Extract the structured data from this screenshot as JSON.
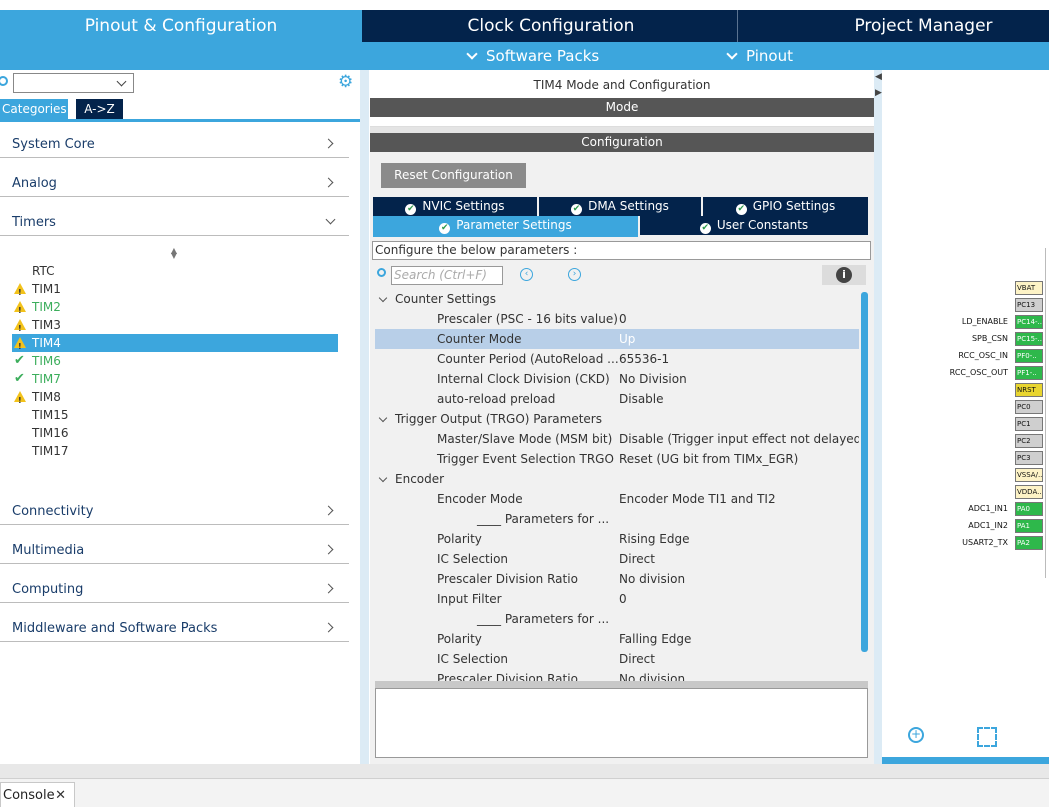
{
  "nav": {
    "tabs": [
      {
        "label": "Pinout & Configuration"
      },
      {
        "label": "Clock Configuration"
      },
      {
        "label": "Project Manager"
      }
    ],
    "sub": [
      {
        "label": "Software Packs"
      },
      {
        "label": "Pinout"
      }
    ]
  },
  "sidebar": {
    "tab_categories": "Categories",
    "tab_az": "A->Z",
    "categories_top": [
      {
        "label": "System Core"
      },
      {
        "label": "Analog"
      },
      {
        "label": "Timers"
      }
    ],
    "timers": [
      {
        "label": "RTC",
        "status": "none"
      },
      {
        "label": "TIM1",
        "status": "warning"
      },
      {
        "label": "TIM2",
        "status": "warning-green"
      },
      {
        "label": "TIM3",
        "status": "warning"
      },
      {
        "label": "TIM4",
        "status": "warning-selected"
      },
      {
        "label": "TIM6",
        "status": "ok"
      },
      {
        "label": "TIM7",
        "status": "ok"
      },
      {
        "label": "TIM8",
        "status": "warning"
      },
      {
        "label": "TIM15",
        "status": "none"
      },
      {
        "label": "TIM16",
        "status": "none"
      },
      {
        "label": "TIM17",
        "status": "none"
      }
    ],
    "categories_bottom": [
      {
        "label": "Connectivity"
      },
      {
        "label": "Multimedia"
      },
      {
        "label": "Computing"
      },
      {
        "label": "Middleware and Software Packs"
      }
    ]
  },
  "main": {
    "title": "TIM4 Mode and Configuration",
    "mode_header": "Mode",
    "config_header": "Configuration",
    "reset_button": "Reset Configuration",
    "settings_tabs": [
      {
        "label": "NVIC Settings"
      },
      {
        "label": "DMA Settings"
      },
      {
        "label": "GPIO Settings"
      },
      {
        "label": "Parameter Settings"
      },
      {
        "label": "User Constants"
      }
    ],
    "params_label": "Configure the below parameters :",
    "search_placeholder": "Search (Ctrl+F)",
    "rows": [
      {
        "type": "group",
        "name": "Counter Settings"
      },
      {
        "type": "param",
        "name": "Prescaler (PSC - 16 bits value)",
        "value": "0"
      },
      {
        "type": "param",
        "name": "Counter Mode",
        "value": "Up",
        "selected": true
      },
      {
        "type": "param",
        "name": "Counter Period (AutoReload ...",
        "value": "65536-1"
      },
      {
        "type": "param",
        "name": "Internal Clock Division (CKD)",
        "value": "No Division"
      },
      {
        "type": "param",
        "name": "auto-reload preload",
        "value": "Disable"
      },
      {
        "type": "group",
        "name": "Trigger Output (TRGO) Parameters"
      },
      {
        "type": "param",
        "name": "Master/Slave Mode (MSM bit)",
        "value": "Disable (Trigger input effect not delayed)"
      },
      {
        "type": "param",
        "name": "Trigger Event Selection TRGO",
        "value": "Reset (UG bit from TIMx_EGR)"
      },
      {
        "type": "group",
        "name": "Encoder"
      },
      {
        "type": "param",
        "name": "Encoder Mode",
        "value": "Encoder Mode TI1 and TI2"
      },
      {
        "type": "param",
        "name": "____ Parameters for ...",
        "value": "",
        "indent": true
      },
      {
        "type": "param",
        "name": "Polarity",
        "value": "Rising Edge"
      },
      {
        "type": "param",
        "name": "IC Selection",
        "value": "Direct"
      },
      {
        "type": "param",
        "name": "Prescaler Division Ratio",
        "value": "No division"
      },
      {
        "type": "param",
        "name": "Input Filter",
        "value": "0"
      },
      {
        "type": "param",
        "name": "____ Parameters for ...",
        "value": "",
        "indent": true
      },
      {
        "type": "param",
        "name": "Polarity",
        "value": "Falling Edge"
      },
      {
        "type": "param",
        "name": "IC Selection",
        "value": "Direct"
      },
      {
        "type": "param",
        "name": "Prescaler Division Ratio",
        "value": "No division"
      }
    ]
  },
  "chip": {
    "pins": [
      {
        "pin": "VBAT",
        "label": "",
        "color": "beige"
      },
      {
        "pin": "PC13",
        "label": "",
        "color": "gray"
      },
      {
        "pin": "PC14-..",
        "label": "LD_ENABLE",
        "color": "green"
      },
      {
        "pin": "PC15-..",
        "label": "SPB_CSN",
        "color": "green"
      },
      {
        "pin": "PF0-..",
        "label": "RCC_OSC_IN",
        "color": "green"
      },
      {
        "pin": "PF1-..",
        "label": "RCC_OSC_OUT",
        "color": "green"
      },
      {
        "pin": "NRST",
        "label": "",
        "color": "yellow"
      },
      {
        "pin": "PC0",
        "label": "",
        "color": "gray"
      },
      {
        "pin": "PC1",
        "label": "",
        "color": "gray"
      },
      {
        "pin": "PC2",
        "label": "",
        "color": "gray"
      },
      {
        "pin": "PC3",
        "label": "",
        "color": "gray"
      },
      {
        "pin": "VSSA/..",
        "label": "",
        "color": "beige"
      },
      {
        "pin": "VDDA..",
        "label": "",
        "color": "beige"
      },
      {
        "pin": "PA0",
        "label": "ADC1_IN1",
        "color": "green"
      },
      {
        "pin": "PA1",
        "label": "ADC1_IN2",
        "color": "green"
      },
      {
        "pin": "PA2",
        "label": "USART2_TX",
        "color": "green"
      }
    ]
  },
  "console": {
    "label": "Console"
  },
  "colors": {
    "accent": "#3ca6dd",
    "dark": "#03234b",
    "ok": "#3cae5c",
    "warn": "#f2c21b"
  }
}
